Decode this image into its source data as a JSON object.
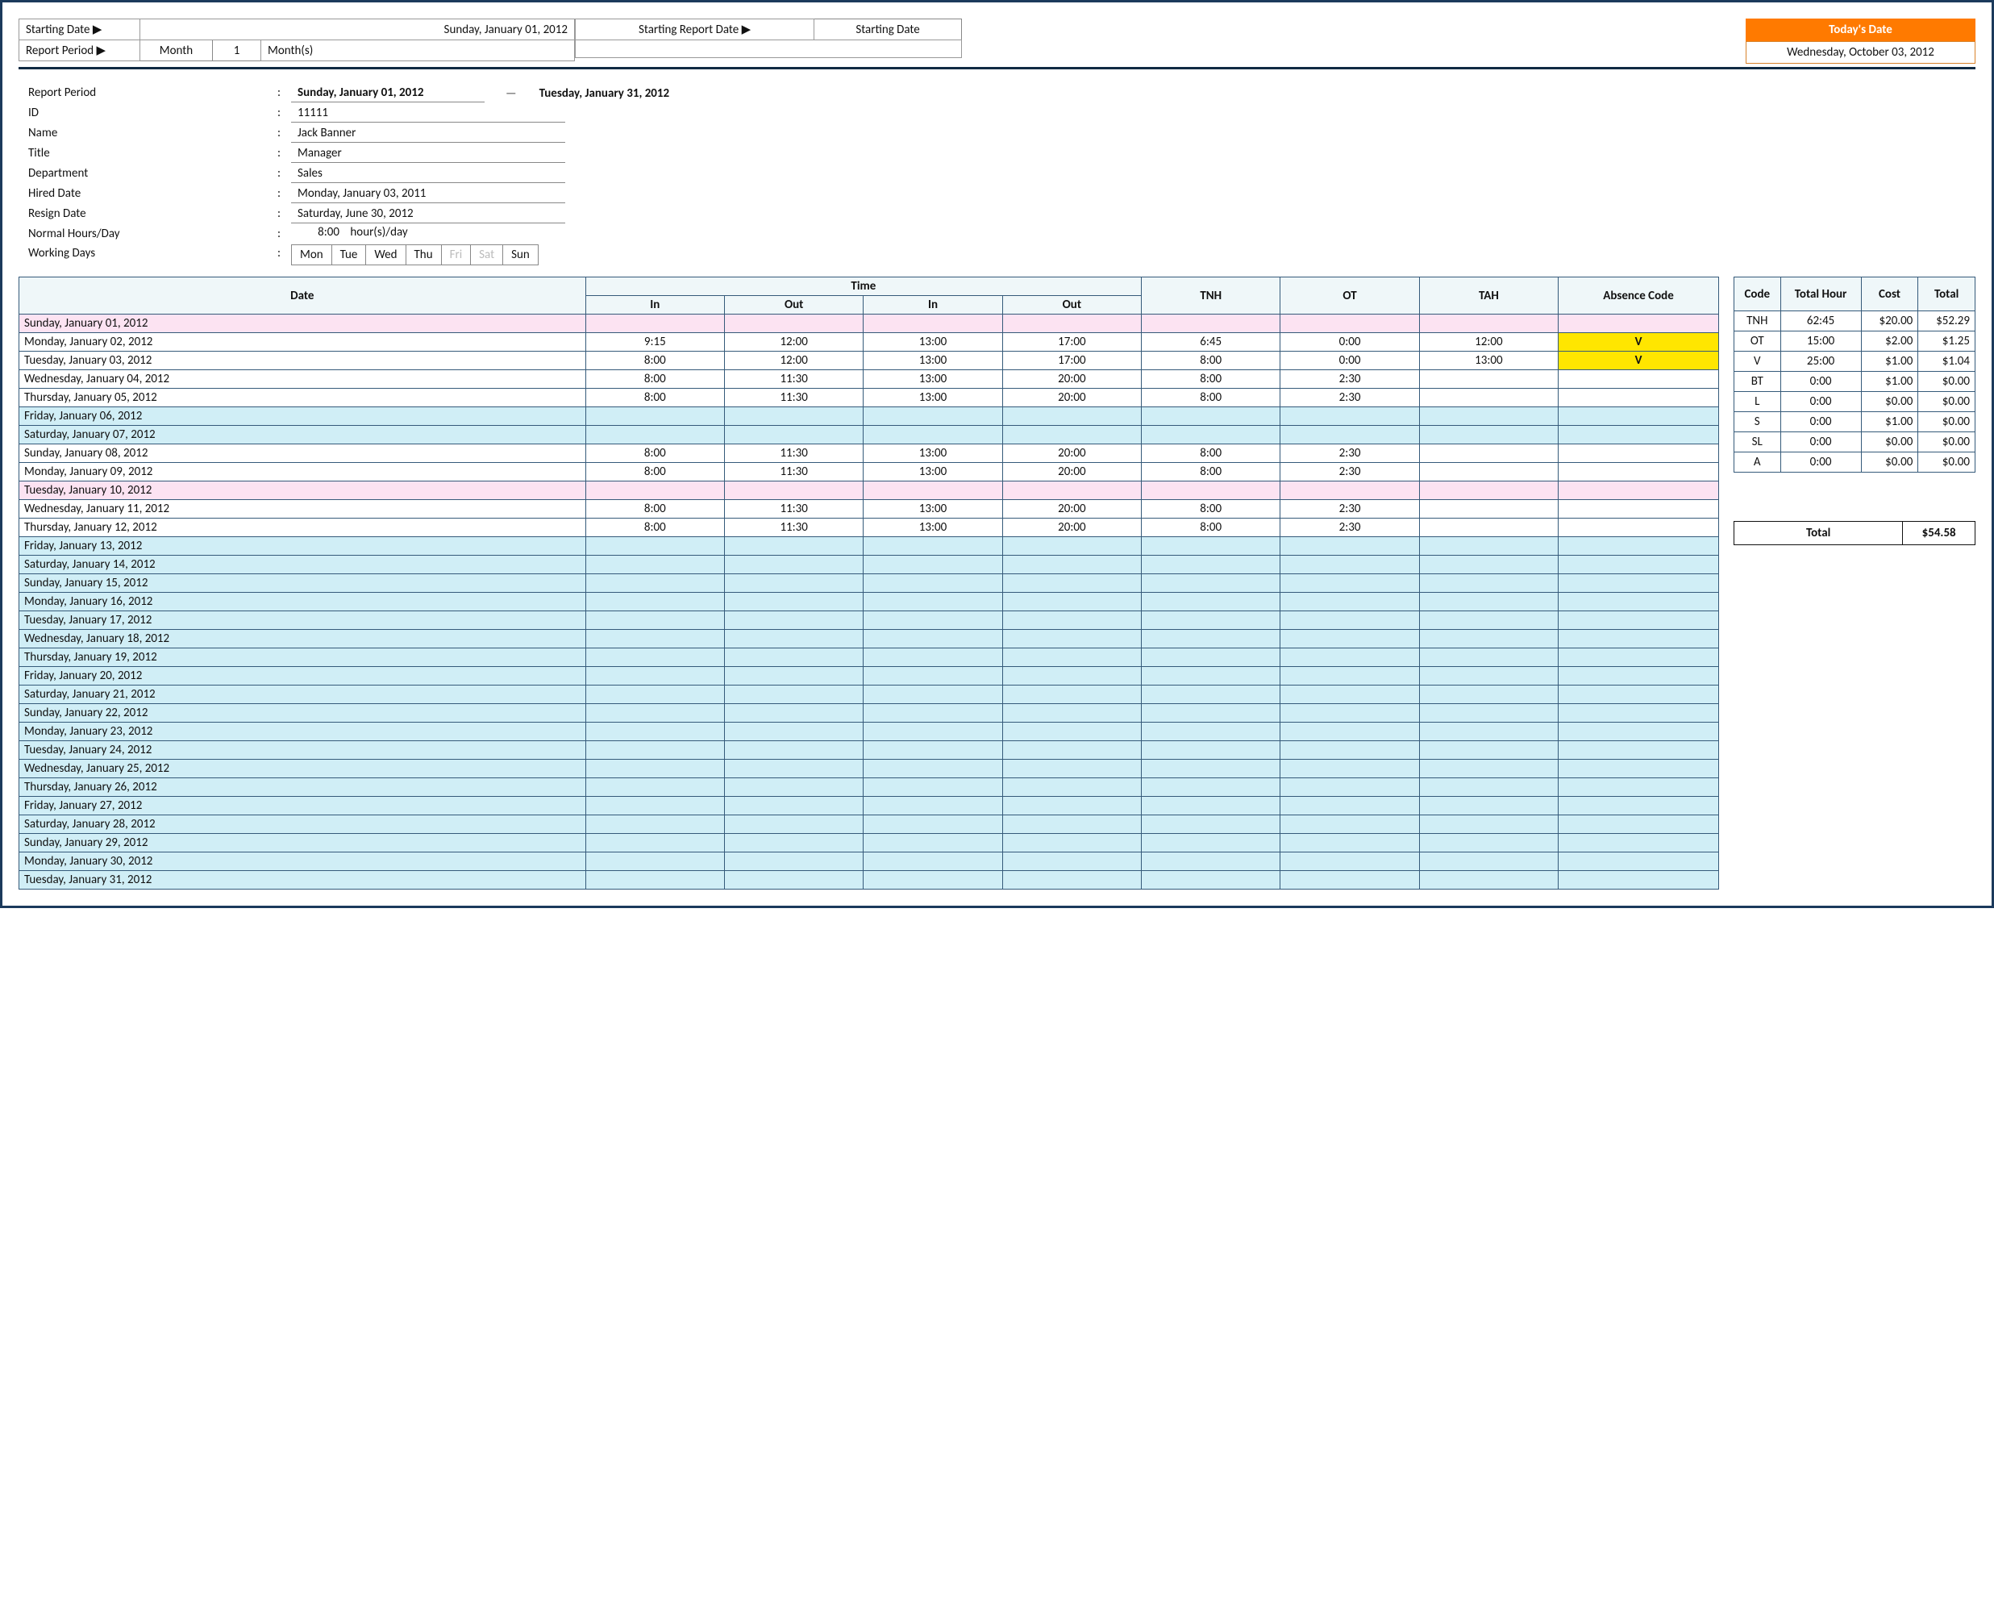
{
  "top": {
    "starting_date_label": "Starting Date ▶",
    "starting_date_value": "Sunday, January 01, 2012",
    "report_period_label": "Report Period ▶",
    "report_period_unit": "Month",
    "report_period_qty": "1",
    "report_period_suffix": "Month(s)",
    "starting_report_date_label": "Starting Report Date ▶",
    "starting_report_date_value": "Starting Date",
    "todays_date_label": "Today's Date",
    "todays_date_value": "Wednesday, October 03, 2012"
  },
  "info": {
    "report_period_label": "Report Period",
    "report_period_from": "Sunday, January 01, 2012",
    "report_period_to": "Tuesday, January 31, 2012",
    "id_label": "ID",
    "id_value": "11111",
    "name_label": "Name",
    "name_value": "Jack Banner",
    "title_label": "Title",
    "title_value": "Manager",
    "dept_label": "Department",
    "dept_value": "Sales",
    "hired_label": "Hired Date",
    "hired_value": "Monday, January 03, 2011",
    "resign_label": "Resign Date",
    "resign_value": "Saturday, June 30, 2012",
    "normal_hours_label": "Normal Hours/Day",
    "normal_hours_value": "8:00",
    "normal_hours_suffix": "hour(s)/day",
    "working_days_label": "Working Days",
    "wd": [
      "Mon",
      "Tue",
      "Wed",
      "Thu",
      "Fri",
      "Sat",
      "Sun"
    ]
  },
  "ts_headers": {
    "date": "Date",
    "time": "Time",
    "in": "In",
    "out": "Out",
    "tnh": "TNH",
    "ot": "OT",
    "tah": "TAH",
    "absence": "Absence Code"
  },
  "rows": [
    {
      "date": "Sunday, January 01, 2012",
      "cls": "pink"
    },
    {
      "date": "Monday, January 02, 2012",
      "cls": "plain",
      "in1": "9:15",
      "out1": "12:00",
      "in2": "13:00",
      "out2": "17:00",
      "tnh": "6:45",
      "ot": "0:00",
      "tah": "12:00",
      "abs": "V"
    },
    {
      "date": "Tuesday, January 03, 2012",
      "cls": "plain",
      "in1": "8:00",
      "out1": "12:00",
      "in2": "13:00",
      "out2": "17:00",
      "tnh": "8:00",
      "ot": "0:00",
      "tah": "13:00",
      "abs": "V"
    },
    {
      "date": "Wednesday, January 04, 2012",
      "cls": "plain",
      "in1": "8:00",
      "out1": "11:30",
      "in2": "13:00",
      "out2": "20:00",
      "tnh": "8:00",
      "ot": "2:30"
    },
    {
      "date": "Thursday, January 05, 2012",
      "cls": "plain",
      "in1": "8:00",
      "out1": "11:30",
      "in2": "13:00",
      "out2": "20:00",
      "tnh": "8:00",
      "ot": "2:30"
    },
    {
      "date": "Friday, January 06, 2012",
      "cls": "blue"
    },
    {
      "date": "Saturday, January 07, 2012",
      "cls": "blue"
    },
    {
      "date": "Sunday, January 08, 2012",
      "cls": "plain",
      "in1": "8:00",
      "out1": "11:30",
      "in2": "13:00",
      "out2": "20:00",
      "tnh": "8:00",
      "ot": "2:30"
    },
    {
      "date": "Monday, January 09, 2012",
      "cls": "plain",
      "in1": "8:00",
      "out1": "11:30",
      "in2": "13:00",
      "out2": "20:00",
      "tnh": "8:00",
      "ot": "2:30"
    },
    {
      "date": "Tuesday, January 10, 2012",
      "cls": "pink"
    },
    {
      "date": "Wednesday, January 11, 2012",
      "cls": "plain",
      "in1": "8:00",
      "out1": "11:30",
      "in2": "13:00",
      "out2": "20:00",
      "tnh": "8:00",
      "ot": "2:30"
    },
    {
      "date": "Thursday, January 12, 2012",
      "cls": "plain",
      "in1": "8:00",
      "out1": "11:30",
      "in2": "13:00",
      "out2": "20:00",
      "tnh": "8:00",
      "ot": "2:30"
    },
    {
      "date": "Friday, January 13, 2012",
      "cls": "blue"
    },
    {
      "date": "Saturday, January 14, 2012",
      "cls": "blue"
    },
    {
      "date": "Sunday, January 15, 2012",
      "cls": "blue"
    },
    {
      "date": "Monday, January 16, 2012",
      "cls": "blue"
    },
    {
      "date": "Tuesday, January 17, 2012",
      "cls": "blue"
    },
    {
      "date": "Wednesday, January 18, 2012",
      "cls": "blue"
    },
    {
      "date": "Thursday, January 19, 2012",
      "cls": "blue"
    },
    {
      "date": "Friday, January 20, 2012",
      "cls": "blue"
    },
    {
      "date": "Saturday, January 21, 2012",
      "cls": "blue"
    },
    {
      "date": "Sunday, January 22, 2012",
      "cls": "blue"
    },
    {
      "date": "Monday, January 23, 2012",
      "cls": "blue"
    },
    {
      "date": "Tuesday, January 24, 2012",
      "cls": "blue"
    },
    {
      "date": "Wednesday, January 25, 2012",
      "cls": "blue"
    },
    {
      "date": "Thursday, January 26, 2012",
      "cls": "blue"
    },
    {
      "date": "Friday, January 27, 2012",
      "cls": "blue"
    },
    {
      "date": "Saturday, January 28, 2012",
      "cls": "blue"
    },
    {
      "date": "Sunday, January 29, 2012",
      "cls": "blue"
    },
    {
      "date": "Monday, January 30, 2012",
      "cls": "blue"
    },
    {
      "date": "Tuesday, January 31, 2012",
      "cls": "blue"
    }
  ],
  "summary_headers": {
    "code": "Code",
    "total_hour": "Total Hour",
    "cost": "Cost",
    "total": "Total"
  },
  "summary": [
    {
      "code": "TNH",
      "hour": "62:45",
      "cost": "$20.00",
      "tot": "$52.29"
    },
    {
      "code": "OT",
      "hour": "15:00",
      "cost": "$2.00",
      "tot": "$1.25"
    },
    {
      "code": "V",
      "hour": "25:00",
      "cost": "$1.00",
      "tot": "$1.04"
    },
    {
      "code": "BT",
      "hour": "0:00",
      "cost": "$1.00",
      "tot": "$0.00"
    },
    {
      "code": "L",
      "hour": "0:00",
      "cost": "$0.00",
      "tot": "$0.00"
    },
    {
      "code": "S",
      "hour": "0:00",
      "cost": "$1.00",
      "tot": "$0.00"
    },
    {
      "code": "SL",
      "hour": "0:00",
      "cost": "$0.00",
      "tot": "$0.00"
    },
    {
      "code": "A",
      "hour": "0:00",
      "cost": "$0.00",
      "tot": "$0.00"
    }
  ],
  "grand_total": {
    "label": "Total",
    "value": "$54.58"
  }
}
